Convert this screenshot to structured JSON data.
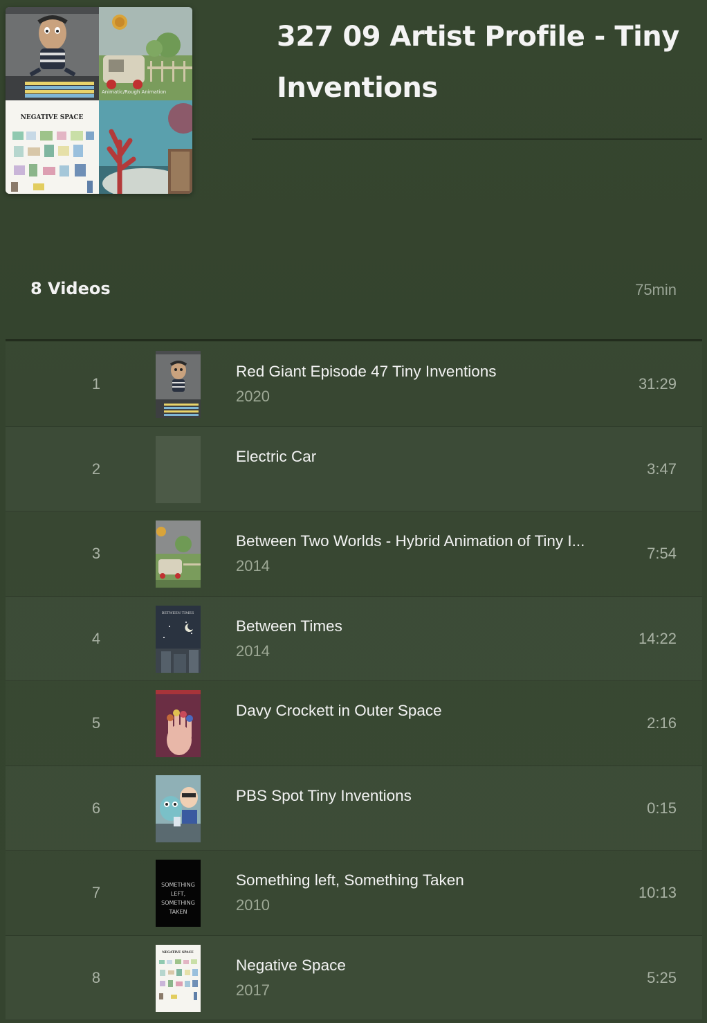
{
  "playlist": {
    "title": "327 09 Artist Profile - Tiny Inventions",
    "video_count": "8 Videos",
    "total_duration": "75min",
    "cover_label_b": "Animatic/Rough Animation",
    "cover_label_c": "NEGATIVE SPACE"
  },
  "colors": {
    "background": "#34422e",
    "divider": "#222c1d",
    "text_primary": "#f3f3f3",
    "text_secondary": "#9ea996"
  },
  "videos": [
    {
      "index": "1",
      "title": "Red Giant Episode 47 Tiny Inventions",
      "year": "2020",
      "duration": "31:29",
      "thumb": "red-giant-thumbnail"
    },
    {
      "index": "2",
      "title": "Electric Car",
      "year": "",
      "duration": "3:47",
      "thumb": "blank-thumbnail"
    },
    {
      "index": "3",
      "title": "Between Two Worlds - Hybrid Animation of Tiny I...",
      "year": "2014",
      "duration": "7:54",
      "thumb": "between-two-worlds-thumbnail"
    },
    {
      "index": "4",
      "title": "Between Times",
      "year": "2014",
      "duration": "14:22",
      "thumb": "between-times-thumbnail",
      "thumb_text": "BETWEEN TIMES"
    },
    {
      "index": "5",
      "title": "Davy Crockett in Outer Space",
      "year": "",
      "duration": "2:16",
      "thumb": "davy-crockett-thumbnail"
    },
    {
      "index": "6",
      "title": "PBS Spot Tiny Inventions",
      "year": "",
      "duration": "0:15",
      "thumb": "pbs-spot-thumbnail"
    },
    {
      "index": "7",
      "title": "Something left, Something Taken",
      "year": "2010",
      "duration": "10:13",
      "thumb": "something-left-thumbnail",
      "thumb_text": "SOMETHING LEFT, SOMETHING TAKEN"
    },
    {
      "index": "8",
      "title": "Negative Space",
      "year": "2017",
      "duration": "5:25",
      "thumb": "negative-space-thumbnail",
      "thumb_text": "NEGATIVE SPACE"
    }
  ]
}
